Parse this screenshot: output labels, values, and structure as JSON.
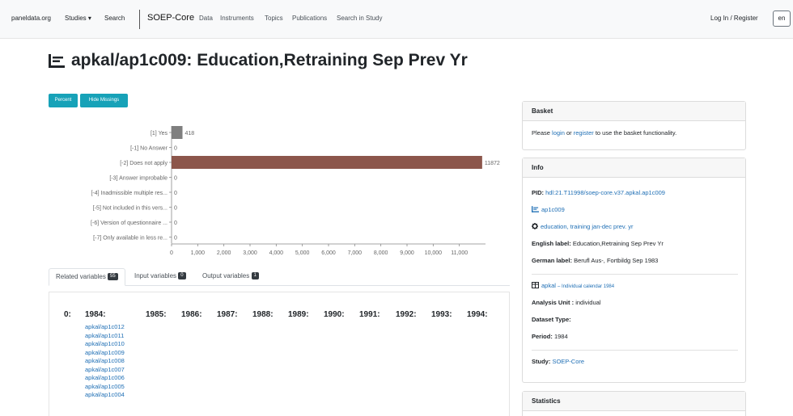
{
  "nav": {
    "brand": "paneldata.org",
    "studies": "Studies ▾",
    "search": "Search",
    "brand2": "SOEP-Core",
    "links": [
      "Data",
      "Instruments",
      "Topics",
      "Publications",
      "Search in Study"
    ],
    "login": "Log In / Register",
    "lang": "en"
  },
  "title": "apkal/ap1c009: Education,Retraining Sep Prev Yr",
  "buttons": {
    "percent": "Percent",
    "hide_missings": "Hide Missings"
  },
  "chart_data": {
    "type": "bar",
    "orientation": "horizontal",
    "categories": [
      "[1] Yes",
      "[-1] No Answer",
      "[-2] Does not apply",
      "[-3] Answer improbable",
      "[-4] Inadmissible multiple res...",
      "[-5] Not included in this vers...",
      "[-6] Version of questionnaire ...",
      "[-7] Only available in less re..."
    ],
    "values": [
      418,
      0,
      11872,
      0,
      0,
      0,
      0,
      0
    ],
    "value_labels": [
      "418",
      "0",
      "11872",
      "0",
      "0",
      "0",
      "0",
      "0"
    ],
    "colors": [
      "#7f7f7f",
      "#7f7f7f",
      "#8c564b",
      "#7f7f7f",
      "#7f7f7f",
      "#7f7f7f",
      "#7f7f7f",
      "#7f7f7f"
    ],
    "xticks": [
      "0",
      "1,000",
      "2,000",
      "3,000",
      "4,000",
      "5,000",
      "6,000",
      "7,000",
      "8,000",
      "9,000",
      "10,000",
      "11,000"
    ],
    "xlim": [
      0,
      12000
    ]
  },
  "tabs": [
    {
      "label": "Related variables",
      "count": "55"
    },
    {
      "label": "Input variables",
      "count": "0"
    },
    {
      "label": "Output variables",
      "count": "1"
    }
  ],
  "related": {
    "index": "0:",
    "years": [
      "1984:",
      "1985:",
      "1986:",
      "1987:",
      "1988:",
      "1989:",
      "1990:",
      "1991:",
      "1992:",
      "1993:",
      "1994:"
    ],
    "vars_1984": [
      "apkal/ap1c012",
      "apkal/ap1c011",
      "apkal/ap1c010",
      "apkal/ap1c009",
      "apkal/ap1c008",
      "apkal/ap1c007",
      "apkal/ap1c006",
      "apkal/ap1c005",
      "apkal/ap1c004"
    ]
  },
  "basket": {
    "header": "Basket",
    "text_pre": "Please ",
    "login": "login",
    "text_mid": " or ",
    "register": "register",
    "text_post": " to use the basket functionality."
  },
  "info": {
    "header": "Info",
    "pid_label": "PID:",
    "pid_value": "hdl:21.T11998/soep-core.v37.apkal.ap1c009",
    "variable_link": "ap1c009",
    "topic_link": "education, training jan-dec prev. yr",
    "english_label": "English label:",
    "english_value": "Education,Retraining Sep Prev Yr",
    "german_label": "German label:",
    "german_value": "Berufl Aus-, Fortbildg Sep 1983",
    "dataset_link": "apkal",
    "dataset_desc": "– Individual calendar 1984",
    "analysis_unit_label": "Analysis Unit :",
    "analysis_unit_value": "individual",
    "dataset_type_label": "Dataset Type:",
    "period_label": "Period:",
    "period_value": "1984",
    "study_label": "Study:",
    "study_value": "SOEP-Core"
  },
  "statistics": {
    "header": "Statistics"
  }
}
